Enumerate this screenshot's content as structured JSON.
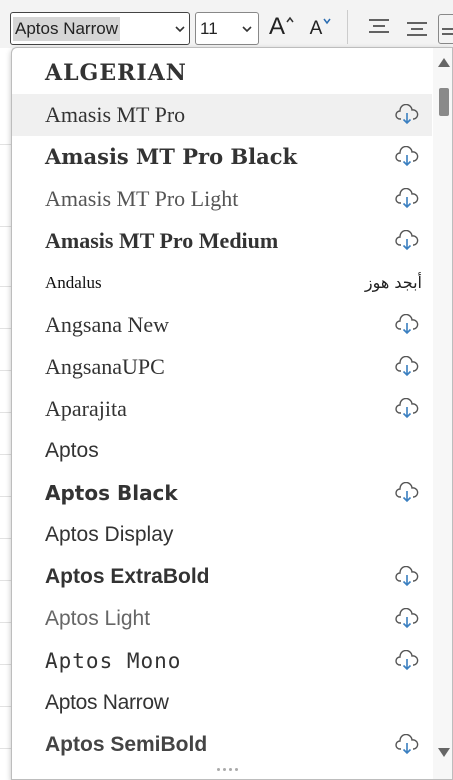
{
  "toolbar": {
    "font_value": "Aptos Narrow",
    "size_value": "11",
    "grow_font": "A",
    "shrink_font": "A"
  },
  "font_list": [
    {
      "name": "ALGERIAN",
      "cloud": false,
      "sample": ""
    },
    {
      "name": "Amasis MT Pro",
      "cloud": true,
      "sample": ""
    },
    {
      "name": "Amasis MT Pro Black",
      "cloud": true,
      "sample": ""
    },
    {
      "name": "Amasis MT Pro Light",
      "cloud": true,
      "sample": ""
    },
    {
      "name": "Amasis MT Pro Medium",
      "cloud": true,
      "sample": ""
    },
    {
      "name": "Andalus",
      "cloud": false,
      "sample": "أبجد هوز"
    },
    {
      "name": "Angsana New",
      "cloud": true,
      "sample": ""
    },
    {
      "name": "AngsanaUPC",
      "cloud": true,
      "sample": ""
    },
    {
      "name": "Aparajita",
      "cloud": true,
      "sample": ""
    },
    {
      "name": "Aptos",
      "cloud": false,
      "sample": ""
    },
    {
      "name": "Aptos Black",
      "cloud": true,
      "sample": ""
    },
    {
      "name": "Aptos Display",
      "cloud": false,
      "sample": ""
    },
    {
      "name": "Aptos ExtraBold",
      "cloud": true,
      "sample": ""
    },
    {
      "name": "Aptos Light",
      "cloud": true,
      "sample": ""
    },
    {
      "name": "Aptos Mono",
      "cloud": true,
      "sample": ""
    },
    {
      "name": "Aptos Narrow",
      "cloud": false,
      "sample": ""
    },
    {
      "name": "Aptos SemiBold",
      "cloud": true,
      "sample": ""
    }
  ],
  "colors": {
    "cloud_icon": "#3a7fc0",
    "hover_row": "#f0f0f0"
  }
}
